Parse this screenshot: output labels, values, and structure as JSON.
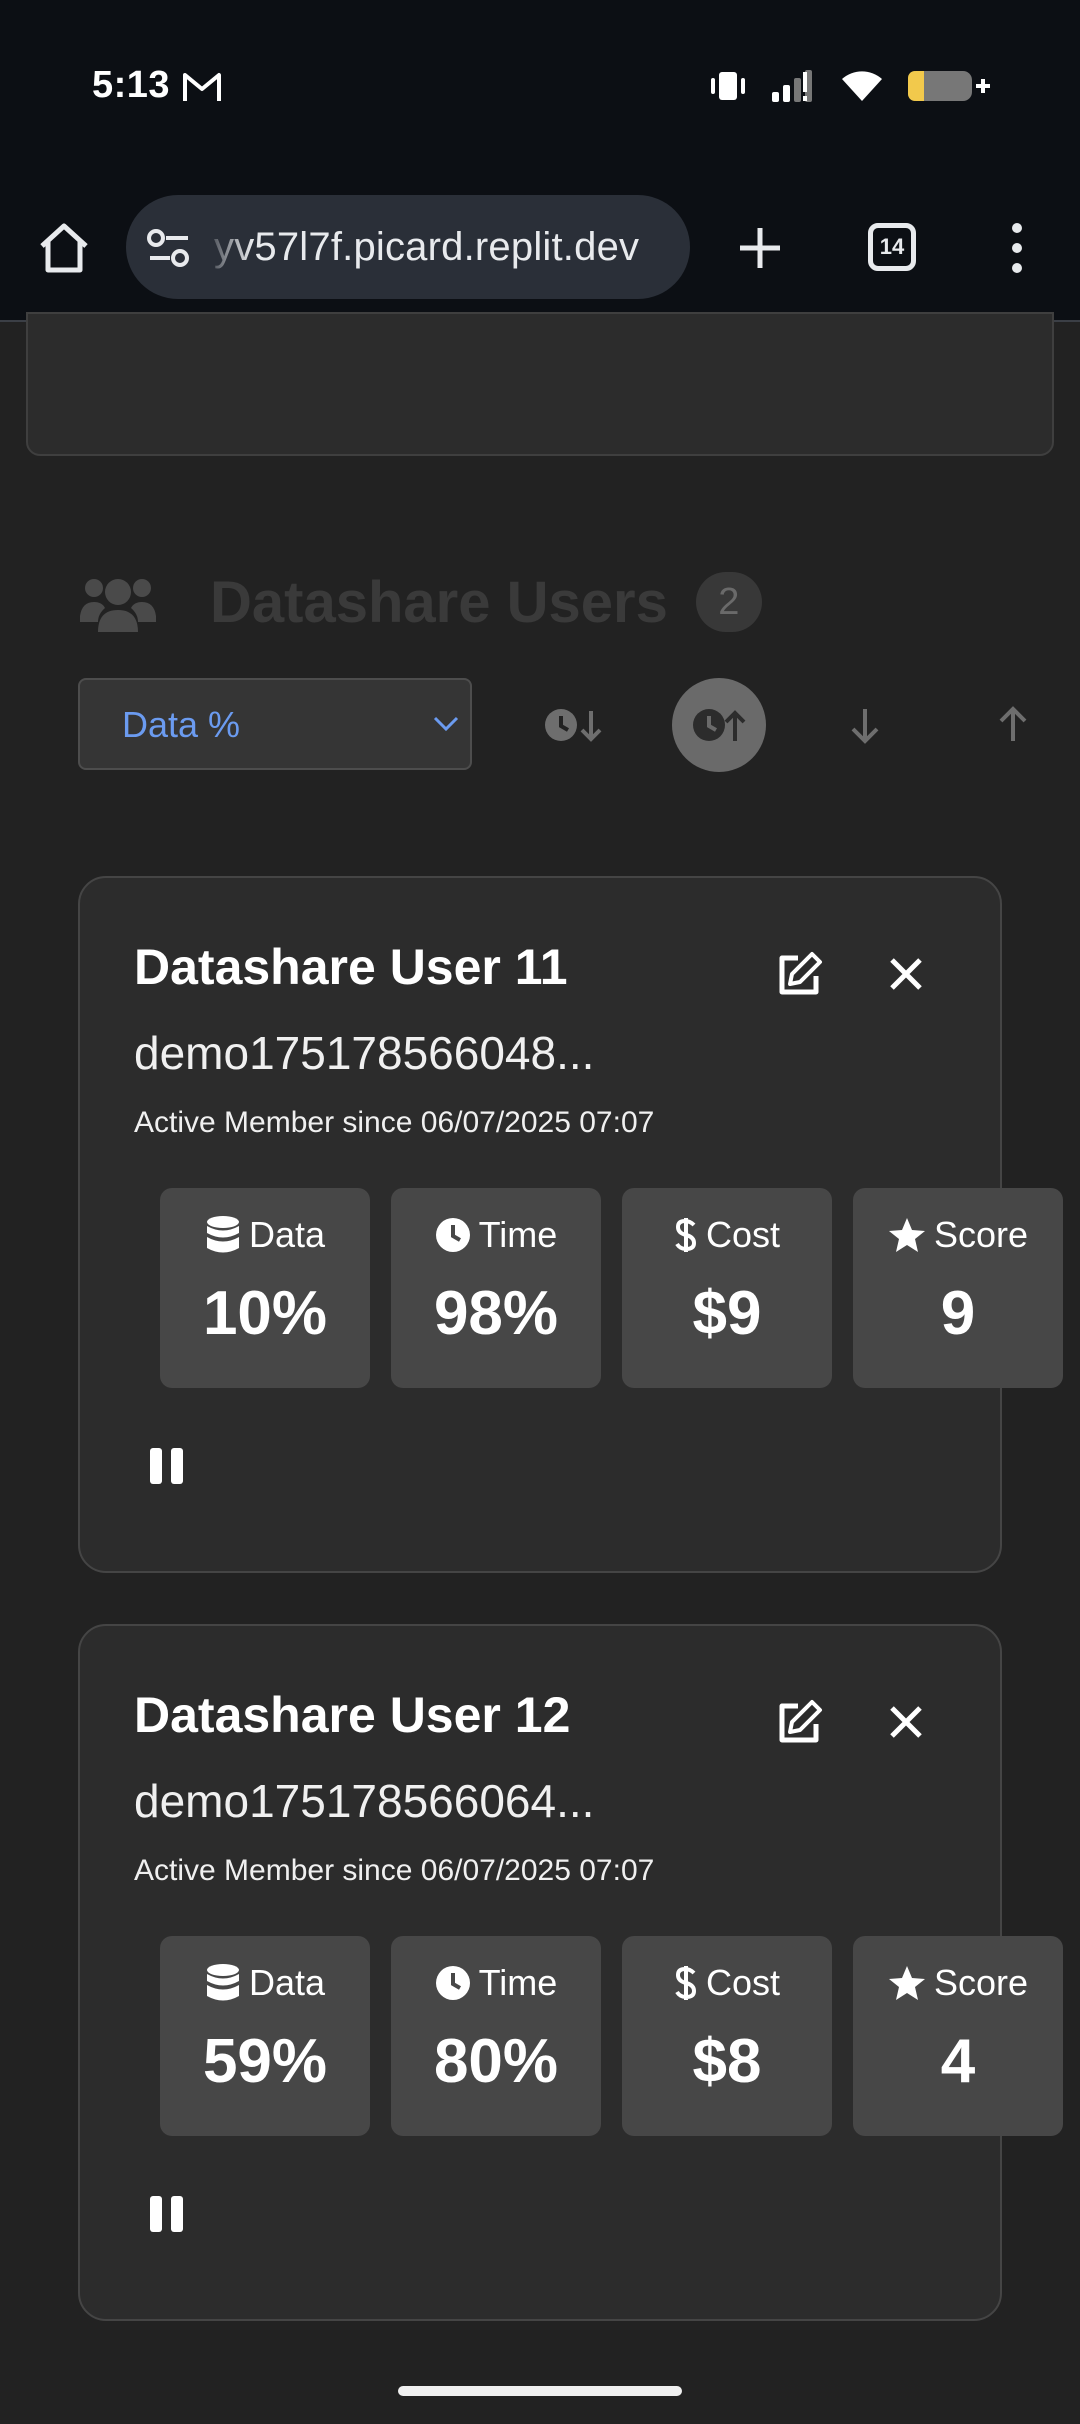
{
  "status_bar": {
    "time": "5:13",
    "icons": [
      "gmail-icon",
      "vibrate-icon",
      "signal-icon",
      "wifi-icon",
      "battery-charging-icon"
    ]
  },
  "browser": {
    "url": "yv57l7f.picard.replit.dev",
    "tab_count": "14",
    "icons": [
      "home-icon",
      "site-settings-icon",
      "new-tab-icon",
      "tab-switcher-icon",
      "more-menu-icon"
    ]
  },
  "section": {
    "title": "Datashare Users",
    "count": "2",
    "icon": "users-icon"
  },
  "sort": {
    "selected": "Data %",
    "buttons": [
      "time-sort-down-icon",
      "time-sort-up-icon",
      "arrow-down-icon",
      "arrow-up-icon"
    ],
    "active_button": "time-sort-up-icon"
  },
  "users": [
    {
      "title": "Datashare User 11",
      "email": "demo175178566048...",
      "since": "Active Member since 06/07/2025 07:07",
      "stats": [
        {
          "label": "Data",
          "value": "10%",
          "icon": "database-icon"
        },
        {
          "label": "Time",
          "value": "98%",
          "icon": "clock-icon"
        },
        {
          "label": "Cost",
          "value": "$9",
          "icon": "dollar-icon"
        },
        {
          "label": "Score",
          "value": "9",
          "icon": "star-icon"
        }
      ]
    },
    {
      "title": "Datashare User 12",
      "email": "demo175178566064...",
      "since": "Active Member since 06/07/2025 07:07",
      "stats": [
        {
          "label": "Data",
          "value": "59%",
          "icon": "database-icon"
        },
        {
          "label": "Time",
          "value": "80%",
          "icon": "clock-icon"
        },
        {
          "label": "Cost",
          "value": "$8",
          "icon": "dollar-icon"
        },
        {
          "label": "Score",
          "value": "4",
          "icon": "star-icon"
        }
      ]
    }
  ],
  "colors": {
    "background": "#222222",
    "card": "#2c2c2c",
    "stat_tile": "#474747",
    "accent": "#6b9bf0"
  }
}
